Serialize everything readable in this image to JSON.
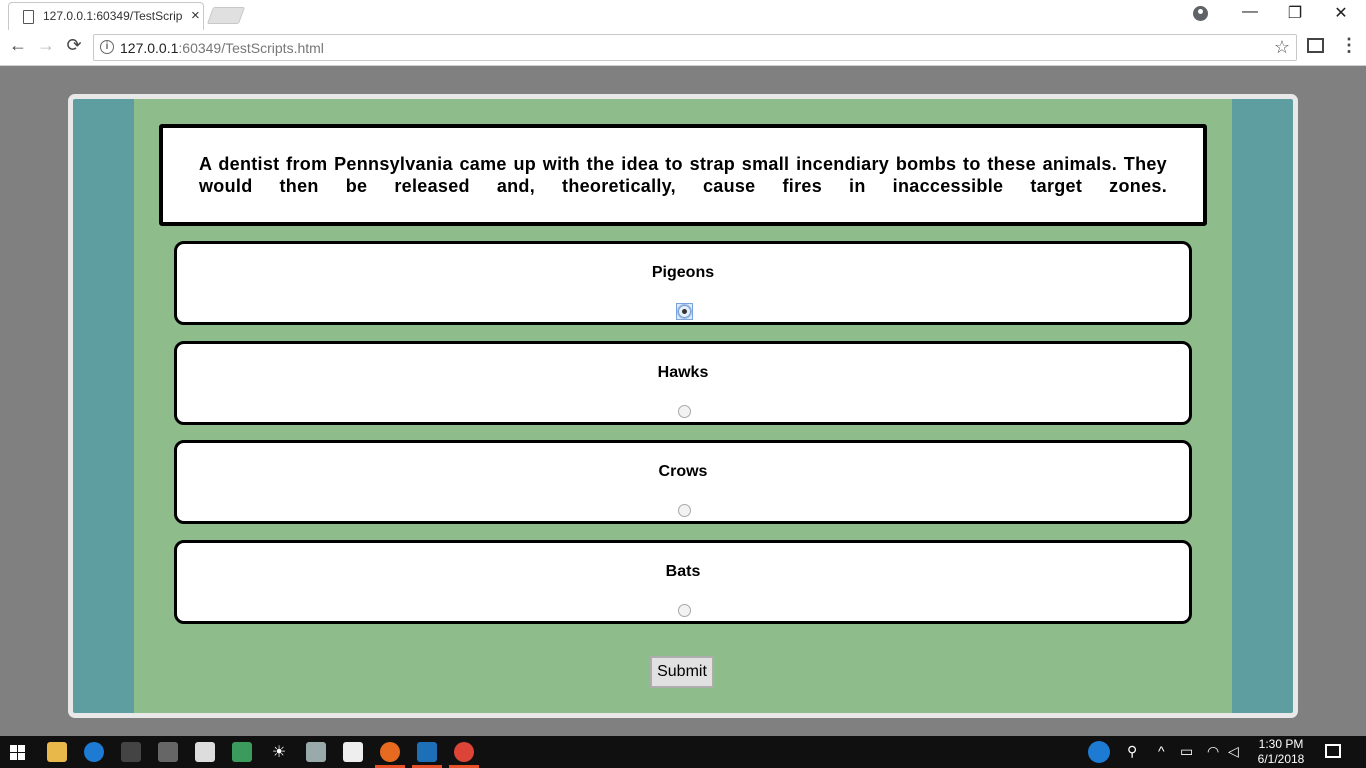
{
  "browser": {
    "tab_title": "127.0.0.1:60349/TestScrip",
    "tab_close": "×",
    "url_host": "127.0.0.1",
    "url_rest": ":60349/TestScripts.html",
    "back_icon": "←",
    "forward_icon": "→",
    "reload_icon": "⟳",
    "star_icon": "☆",
    "menu_icon": "⋮",
    "minimize_icon": "—",
    "maximize_icon": "❐",
    "close_icon": "✕"
  },
  "quiz": {
    "question": "A dentist from Pennsylvania came up with the idea to strap small incendiary bombs to these animals. They would then be released and, theoretically, cause fires in inaccessible target zones.",
    "options": [
      {
        "label": "Pigeons",
        "checked": true
      },
      {
        "label": "Hawks",
        "checked": false
      },
      {
        "label": "Crows",
        "checked": false
      },
      {
        "label": "Bats",
        "checked": false
      }
    ],
    "submit_label": "Submit"
  },
  "taskbar": {
    "time": "1:30 PM",
    "date": "6/1/2018"
  },
  "colors": {
    "page_bg": "#808080",
    "frame_teal": "#5f9ea0",
    "frame_green": "#8fbc8b"
  }
}
